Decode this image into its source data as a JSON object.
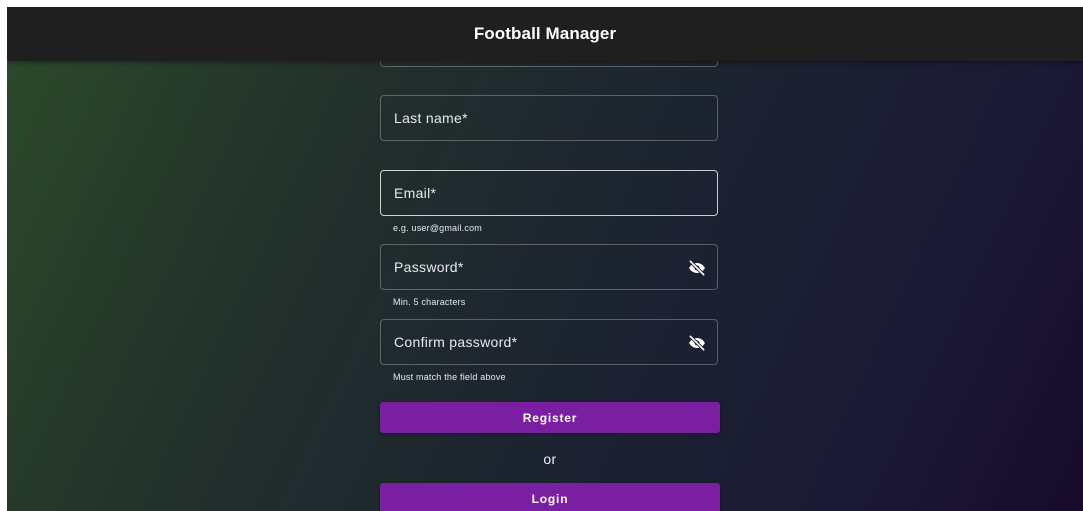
{
  "app": {
    "title": "Football Manager"
  },
  "form": {
    "fields": [
      {
        "label": "",
        "hint": ""
      },
      {
        "label": "Last name*",
        "hint": ""
      },
      {
        "label": "Email*",
        "hint": "e.g. user@gmail.com"
      },
      {
        "label": "Password*",
        "hint": "Min. 5 characters",
        "icon": "visibility-off-icon"
      },
      {
        "label": "Confirm password*",
        "hint": "Must match the field above",
        "icon": "visibility-off-icon"
      }
    ],
    "register_label": "Register",
    "or_label": "or",
    "login_label": "Login"
  },
  "colors": {
    "appbar": "#1f1f1f",
    "button": "#7b1fa2",
    "gradient_start": "#2c4a2a",
    "gradient_end": "#170b2c"
  }
}
